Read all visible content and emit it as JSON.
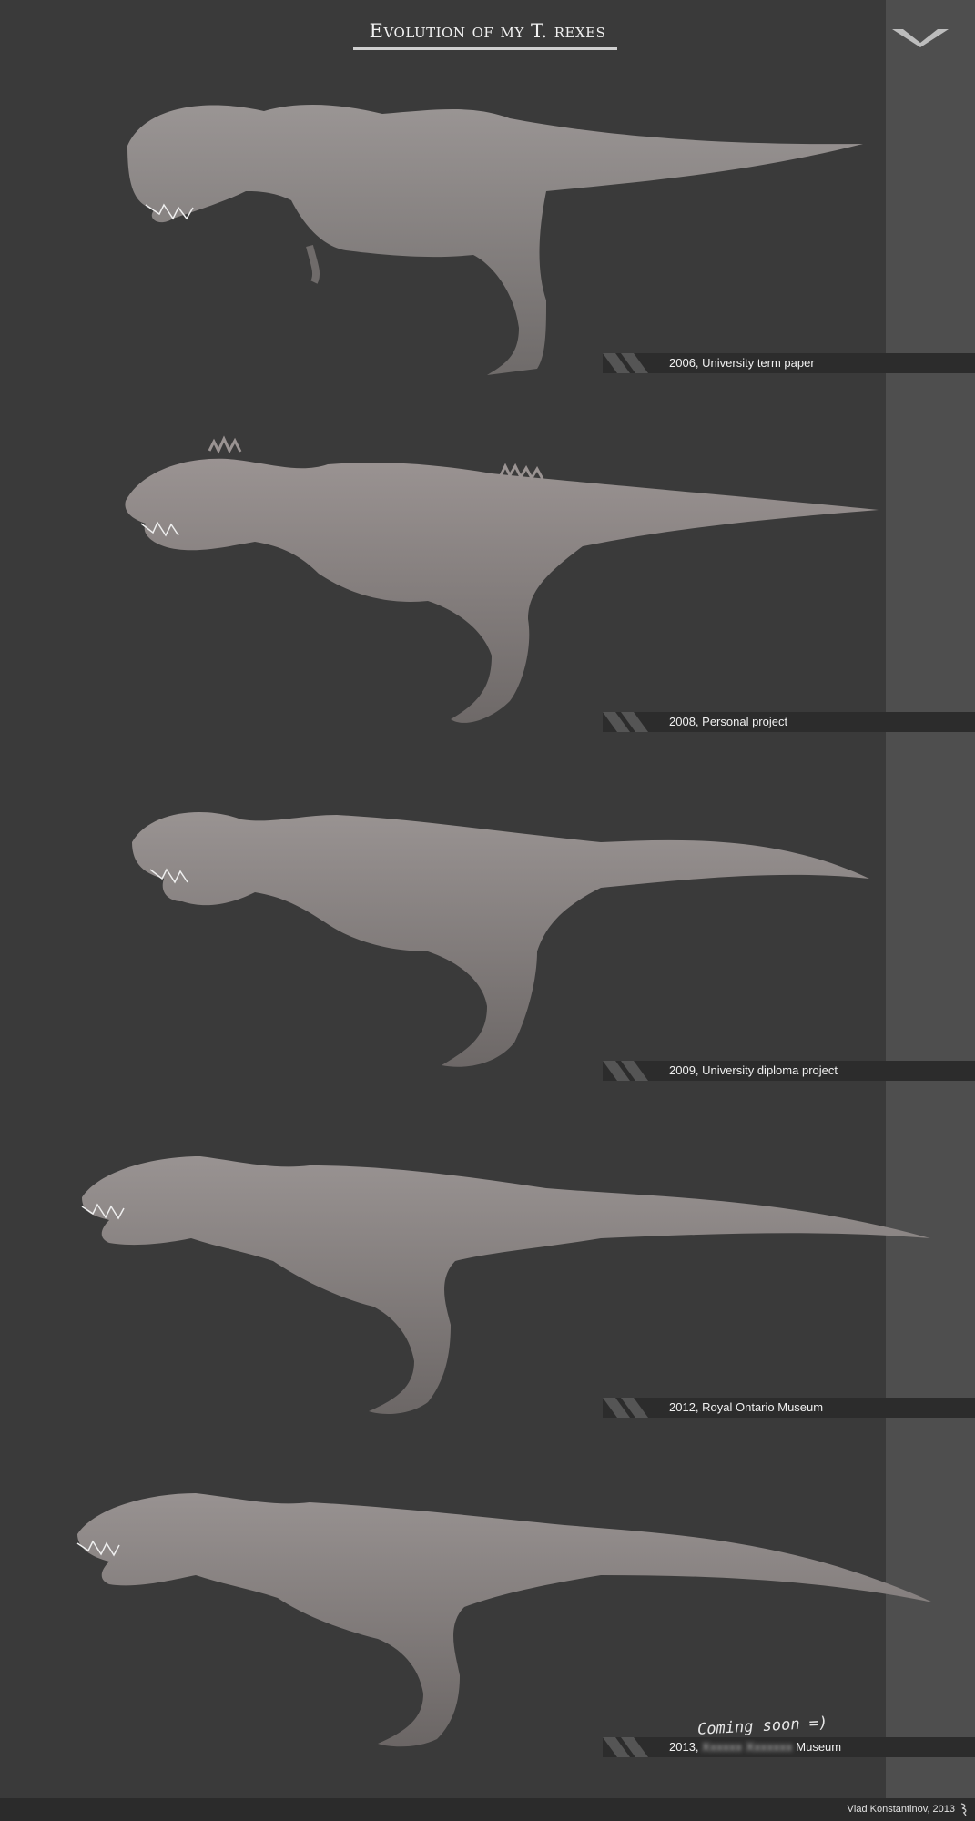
{
  "header": {
    "title": "Evolution of my T. rexes",
    "logo_icon": "v-chevron-logo-icon"
  },
  "entries": [
    {
      "year": "2006",
      "label": "2006, University term paper"
    },
    {
      "year": "2008",
      "label": "2008, Personal project"
    },
    {
      "year": "2009",
      "label": "2009, University diploma project"
    },
    {
      "year": "2012",
      "label": "2012, Royal Ontario Museum"
    },
    {
      "year": "2013",
      "label_prefix": "2013,",
      "label_suffix": "Museum",
      "note": "Coming soon =)"
    }
  ],
  "footer": {
    "credit": "Vlad Konstantinov, 2013",
    "signature_icon": "signature-icon"
  },
  "colors": {
    "background": "#3a3a3a",
    "band": "#4e4e4e",
    "caption_bar": "#2c2c2c",
    "model": "#8a8584"
  }
}
